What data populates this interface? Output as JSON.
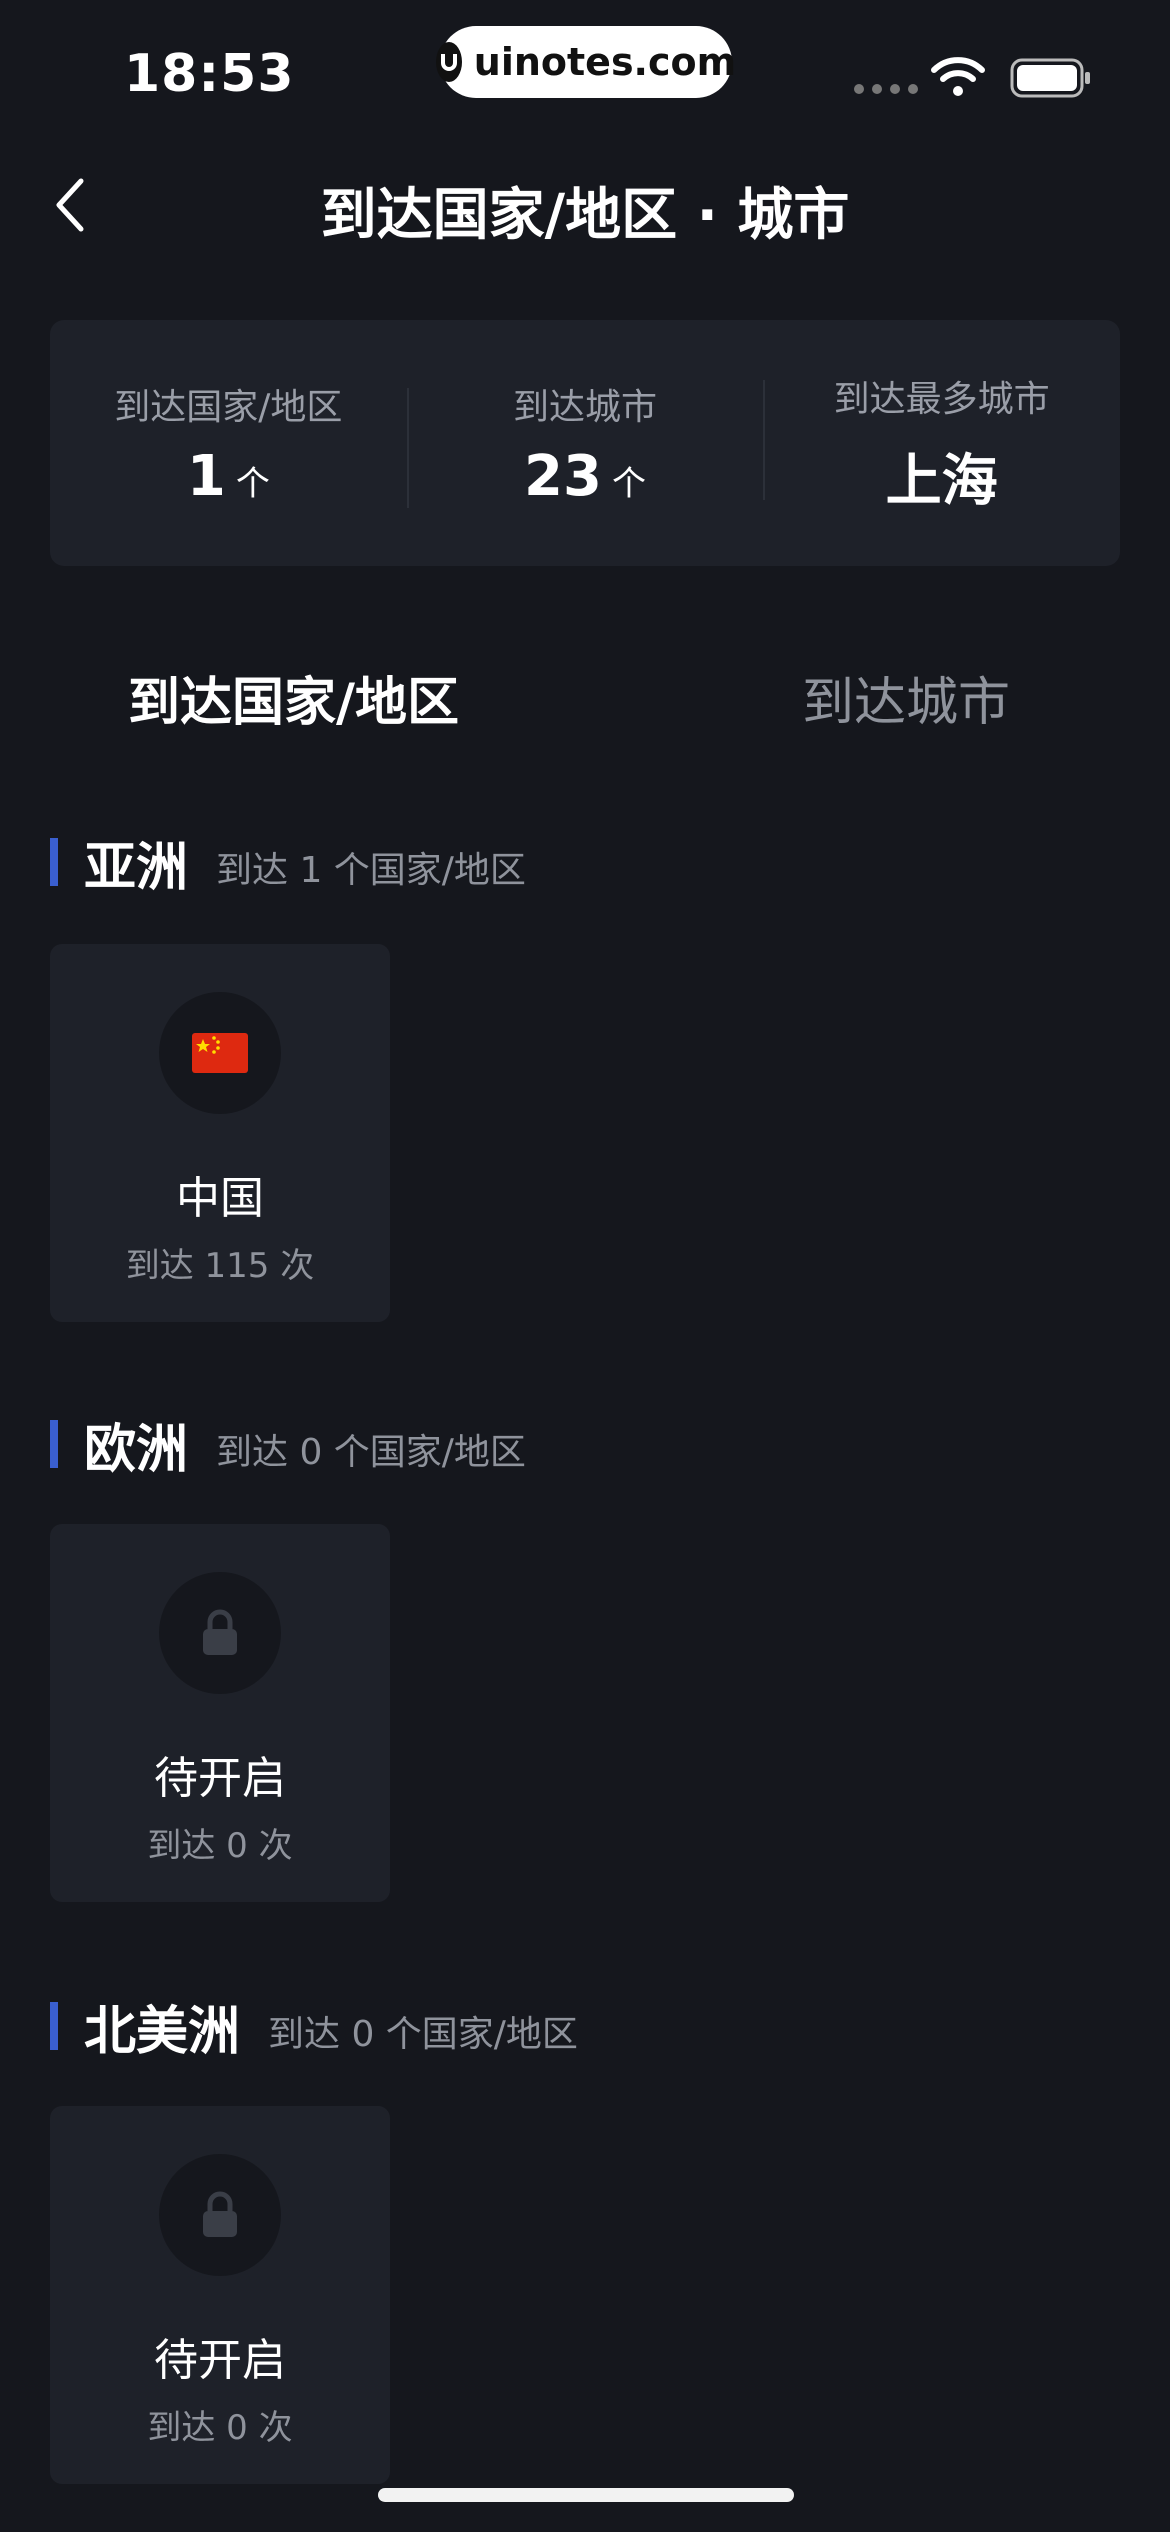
{
  "status_bar": {
    "time": "18:53",
    "watermark": "uinotes.com"
  },
  "nav": {
    "back_icon": "chevron-left-icon",
    "title": "到达国家/地区 · 城市"
  },
  "stats": [
    {
      "label": "到达国家/地区",
      "value": "1",
      "unit": "个"
    },
    {
      "label": "到达城市",
      "value": "23",
      "unit": "个"
    },
    {
      "label": "到达最多城市",
      "value": "上海",
      "unit": ""
    }
  ],
  "tabs": {
    "active": "到达国家/地区",
    "inactive": "到达城市"
  },
  "sections": [
    {
      "title": "亚洲",
      "subtitle": "到达 1 个国家/地区",
      "card": {
        "icon": "china-flag-icon",
        "name": "中国",
        "sub": "到达 115 次"
      }
    },
    {
      "title": "欧洲",
      "subtitle": "到达 0 个国家/地区",
      "card": {
        "icon": "lock-icon",
        "name": "待开启",
        "sub": "到达 0 次"
      }
    },
    {
      "title": "北美洲",
      "subtitle": "到达 0 个国家/地区",
      "card": {
        "icon": "lock-icon",
        "name": "待开启",
        "sub": "到达 0 次"
      }
    }
  ],
  "colors": {
    "background": "#15171d",
    "card": "#1e2129",
    "accent": "#3a5fcf"
  }
}
